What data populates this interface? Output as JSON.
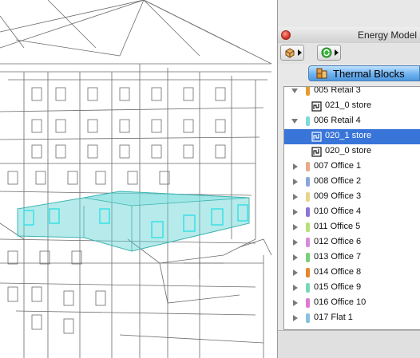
{
  "window": {
    "title": "Energy Model Review"
  },
  "tabs": {
    "active_label": "Thermal Blocks",
    "active_icon": "thermal-blocks-icon"
  },
  "toolbar": {
    "icons": [
      "3d-view-icon",
      "refresh-icon"
    ]
  },
  "tree": {
    "rows": [
      {
        "type": "group",
        "label": "005 Retail 3",
        "expanded": true,
        "color": "#e89a2e"
      },
      {
        "type": "item",
        "label": "021_0 store",
        "selected": false
      },
      {
        "type": "group",
        "label": "006 Retail 4",
        "expanded": true,
        "color": "#7fdada"
      },
      {
        "type": "item",
        "label": "020_1 store",
        "selected": true
      },
      {
        "type": "item",
        "label": "020_0 store",
        "selected": false
      },
      {
        "type": "group",
        "label": "007 Office 1",
        "expanded": false,
        "color": "#e8a88a"
      },
      {
        "type": "group",
        "label": "008 Office 2",
        "expanded": false,
        "color": "#8aa6e0"
      },
      {
        "type": "group",
        "label": "009 Office 3",
        "expanded": false,
        "color": "#e8d48a"
      },
      {
        "type": "group",
        "label": "010 Office 4",
        "expanded": false,
        "color": "#8a76d6"
      },
      {
        "type": "group",
        "label": "011 Office 5",
        "expanded": false,
        "color": "#b8e07a"
      },
      {
        "type": "group",
        "label": "012 Office 6",
        "expanded": false,
        "color": "#d88ae0"
      },
      {
        "type": "group",
        "label": "013 Office 7",
        "expanded": false,
        "color": "#7ad07a"
      },
      {
        "type": "group",
        "label": "014 Office 8",
        "expanded": false,
        "color": "#e8862a"
      },
      {
        "type": "group",
        "label": "015 Office 9",
        "expanded": false,
        "color": "#7ad8b8"
      },
      {
        "type": "group",
        "label": "016 Office 10",
        "expanded": false,
        "color": "#e07ad0"
      },
      {
        "type": "group",
        "label": "017 Flat 1",
        "expanded": false,
        "color": "#8ac0e0"
      }
    ]
  },
  "colors": {
    "selection": "#3975d9",
    "highlight_block": "#5fd0d0"
  }
}
